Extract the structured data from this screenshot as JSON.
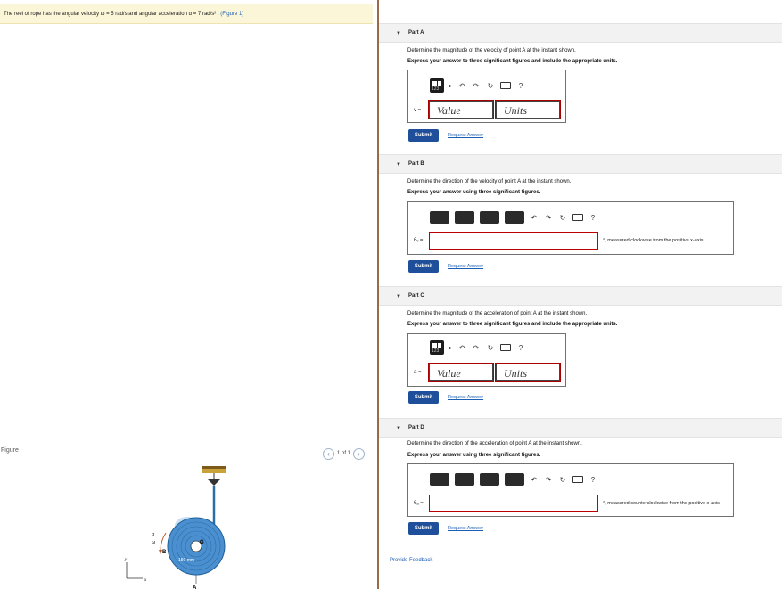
{
  "problem": {
    "text": "The reel of rope has the angular velocity ω = 5  rad/s and angular acceleration α = 7  rad/s² . ",
    "figure_link": "(Figure 1)"
  },
  "figure": {
    "label": "Figure",
    "pager": "1 of 1",
    "prev_icon": "chevron-left-icon",
    "next_icon": "chevron-right-icon",
    "labels": {
      "alpha": "α",
      "omega": "ω",
      "B": "B",
      "G": "G",
      "dim": "150 mm",
      "A": "A",
      "y": "y",
      "x": "x"
    }
  },
  "parts": [
    {
      "title": "Part A",
      "question": "Determine the magnitude of the velocity of point A at the instant shown.",
      "instruction": "Express your answer to three significant figures and include the appropriate units.",
      "var_label": "v =",
      "value_placeholder": "Value",
      "units_placeholder": "Units",
      "submit": "Submit",
      "request": "Request Answer"
    },
    {
      "title": "Part B",
      "question": "Determine the direction of the velocity of point A at the instant shown.",
      "instruction": "Express your answer using three significant figures.",
      "var_label": "θᵥ =",
      "suffix": "°, measured clockwise from the positive x-axis.",
      "submit": "Submit",
      "request": "Request Answer"
    },
    {
      "title": "Part C",
      "question": "Determine the magnitude of the acceleration of point A at the instant shown.",
      "instruction": "Express your answer to three significant figures and include the appropriate units.",
      "var_label": "a =",
      "value_placeholder": "Value",
      "units_placeholder": "Units",
      "submit": "Submit",
      "request": "Request Answer"
    },
    {
      "title": "Part D",
      "question": "Determine the direction of the acceleration of point A at the instant shown.",
      "instruction": "Express your answer using three significant figures.",
      "var_label": "θₐ =",
      "suffix": "°, measured counterclockwise from the positive x-axis.",
      "submit": "Submit",
      "request": "Request Answer"
    }
  ],
  "toolbar": {
    "templates_label": "123↓",
    "undo": "↶",
    "redo": "↷",
    "reset": "↻",
    "keyboard_icon": "keyboard-icon",
    "help": "?"
  },
  "feedback": "Provide Feedback"
}
